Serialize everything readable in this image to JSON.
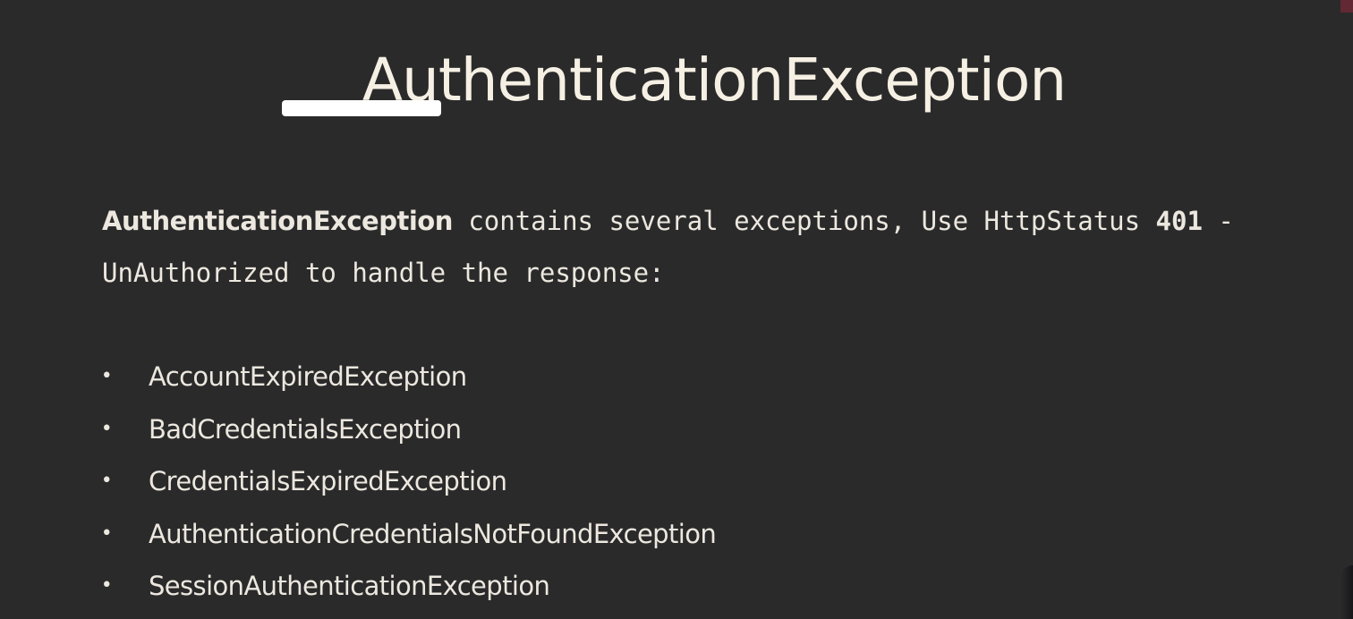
{
  "slide": {
    "title": "AuthenticationException",
    "intro": {
      "subject": "AuthenticationException",
      "text_part1": " contains several exceptions, Use HttpStatus ",
      "status_code": "401",
      "text_part2": " -",
      "line2": "UnAuthorized to handle the response:"
    },
    "bullet_symbol": "•",
    "exceptions": [
      "AccountExpiredException",
      "BadCredentialsException",
      "CredentialsExpiredException",
      "AuthenticationCredentialsNotFoundException",
      "SessionAuthenticationException"
    ]
  },
  "colors": {
    "background": "#2b2a2b",
    "text": "#ece8df",
    "title": "#f5f0e3",
    "highlight_bar": "#ffffff"
  }
}
